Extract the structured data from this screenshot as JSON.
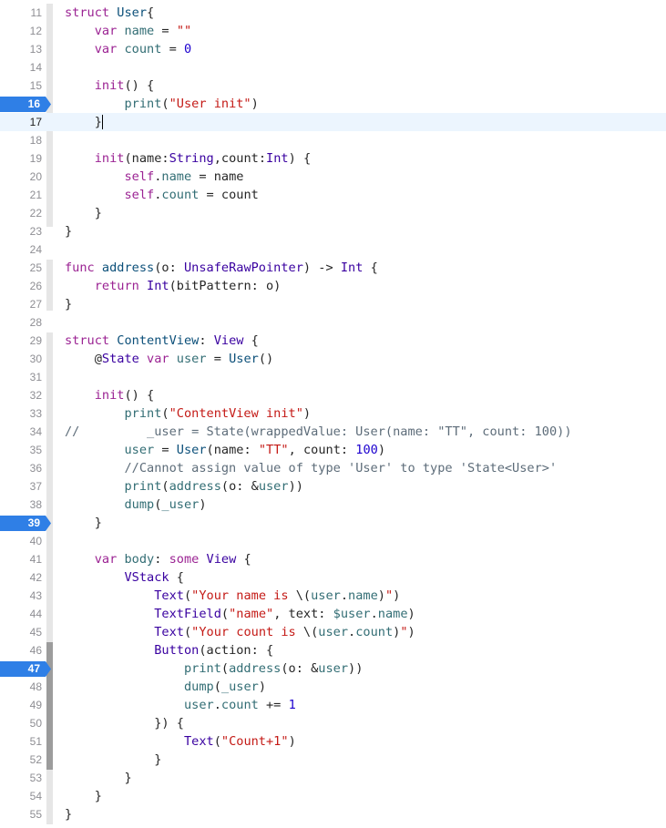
{
  "editor": {
    "colors": {
      "keyword": "#9b2393",
      "type": "#3900a0",
      "string": "#c41a16",
      "number": "#1c00cf",
      "function": "#326d74",
      "comment": "#5d6c79",
      "breakpoint": "#2f7fe6",
      "current_line": "#ecf5fe"
    },
    "current_line": 17,
    "breakpoints": [
      16,
      39,
      47
    ],
    "lines": [
      {
        "n": "11",
        "tokens": [
          [
            "kw",
            "struct "
          ],
          [
            "ty2",
            "User"
          ],
          [
            "",
            "{"
          ]
        ]
      },
      {
        "n": "12",
        "tokens": [
          [
            "",
            "    "
          ],
          [
            "kw",
            "var "
          ],
          [
            "fn",
            "name"
          ],
          [
            "",
            " = "
          ],
          [
            "str",
            "\"\""
          ]
        ]
      },
      {
        "n": "13",
        "tokens": [
          [
            "",
            "    "
          ],
          [
            "kw",
            "var "
          ],
          [
            "fn",
            "count"
          ],
          [
            "",
            " = "
          ],
          [
            "num",
            "0"
          ]
        ]
      },
      {
        "n": "14",
        "tokens": []
      },
      {
        "n": "15",
        "tokens": [
          [
            "",
            "    "
          ],
          [
            "kw",
            "init"
          ],
          [
            "",
            "() {"
          ]
        ]
      },
      {
        "n": "16",
        "tokens": [
          [
            "",
            "        "
          ],
          [
            "fn",
            "print"
          ],
          [
            "",
            "("
          ],
          [
            "str",
            "\"User init\""
          ],
          [
            "",
            ")"
          ]
        ]
      },
      {
        "n": "17",
        "tokens": [
          [
            "",
            "    }"
          ]
        ]
      },
      {
        "n": "18",
        "tokens": []
      },
      {
        "n": "19",
        "tokens": [
          [
            "",
            "    "
          ],
          [
            "kw",
            "init"
          ],
          [
            "",
            "(name:"
          ],
          [
            "ty",
            "String"
          ],
          [
            "",
            ",count:"
          ],
          [
            "ty",
            "Int"
          ],
          [
            "",
            ") {"
          ]
        ]
      },
      {
        "n": "20",
        "tokens": [
          [
            "",
            "        "
          ],
          [
            "kw",
            "self"
          ],
          [
            "",
            "."
          ],
          [
            "fn",
            "name"
          ],
          [
            "",
            " = name"
          ]
        ]
      },
      {
        "n": "21",
        "tokens": [
          [
            "",
            "        "
          ],
          [
            "kw",
            "self"
          ],
          [
            "",
            "."
          ],
          [
            "fn",
            "count"
          ],
          [
            "",
            " = count"
          ]
        ]
      },
      {
        "n": "22",
        "tokens": [
          [
            "",
            "    }"
          ]
        ]
      },
      {
        "n": "23",
        "tokens": [
          [
            "",
            "}"
          ]
        ]
      },
      {
        "n": "24",
        "tokens": []
      },
      {
        "n": "25",
        "tokens": [
          [
            "kw",
            "func "
          ],
          [
            "ty2",
            "address"
          ],
          [
            "",
            "(o: "
          ],
          [
            "ty",
            "UnsafeRawPointer"
          ],
          [
            "",
            ") -> "
          ],
          [
            "ty",
            "Int"
          ],
          [
            "",
            " {"
          ]
        ]
      },
      {
        "n": "26",
        "tokens": [
          [
            "",
            "    "
          ],
          [
            "kw",
            "return "
          ],
          [
            "ty",
            "Int"
          ],
          [
            "",
            "(bitPattern: o)"
          ]
        ]
      },
      {
        "n": "27",
        "tokens": [
          [
            "",
            "}"
          ]
        ]
      },
      {
        "n": "28",
        "tokens": []
      },
      {
        "n": "29",
        "tokens": [
          [
            "kw",
            "struct "
          ],
          [
            "ty2",
            "ContentView"
          ],
          [
            "",
            ": "
          ],
          [
            "ty",
            "View"
          ],
          [
            "",
            " {"
          ]
        ]
      },
      {
        "n": "30",
        "tokens": [
          [
            "",
            "    @"
          ],
          [
            "ty",
            "State"
          ],
          [
            "",
            " "
          ],
          [
            "kw",
            "var "
          ],
          [
            "fn",
            "user"
          ],
          [
            "",
            " = "
          ],
          [
            "ty2",
            "User"
          ],
          [
            "",
            "()"
          ]
        ]
      },
      {
        "n": "31",
        "tokens": []
      },
      {
        "n": "32",
        "tokens": [
          [
            "",
            "    "
          ],
          [
            "kw",
            "init"
          ],
          [
            "",
            "() {"
          ]
        ]
      },
      {
        "n": "33",
        "tokens": [
          [
            "",
            "        "
          ],
          [
            "fn",
            "print"
          ],
          [
            "",
            "("
          ],
          [
            "str",
            "\"ContentView init\""
          ],
          [
            "",
            ")"
          ]
        ]
      },
      {
        "n": "34",
        "tokens": [
          [
            "cm",
            "//         _user = State(wrappedValue: User(name: \"TT\", count: 100))"
          ]
        ]
      },
      {
        "n": "35",
        "tokens": [
          [
            "",
            "        "
          ],
          [
            "fn",
            "user"
          ],
          [
            "",
            " = "
          ],
          [
            "ty2",
            "User"
          ],
          [
            "",
            "(name: "
          ],
          [
            "str",
            "\"TT\""
          ],
          [
            "",
            ", count: "
          ],
          [
            "num",
            "100"
          ],
          [
            "",
            ")"
          ]
        ]
      },
      {
        "n": "36",
        "tokens": [
          [
            "",
            "        "
          ],
          [
            "cm",
            "//Cannot assign value of type 'User' to type 'State<User>'"
          ]
        ]
      },
      {
        "n": "37",
        "tokens": [
          [
            "",
            "        "
          ],
          [
            "fn",
            "print"
          ],
          [
            "",
            "("
          ],
          [
            "fn",
            "address"
          ],
          [
            "",
            "(o: &"
          ],
          [
            "fn",
            "user"
          ],
          [
            "",
            "))"
          ]
        ]
      },
      {
        "n": "38",
        "tokens": [
          [
            "",
            "        "
          ],
          [
            "fn",
            "dump"
          ],
          [
            "",
            "("
          ],
          [
            "fn",
            "_user"
          ],
          [
            "",
            ")"
          ]
        ]
      },
      {
        "n": "39",
        "tokens": [
          [
            "",
            "    }"
          ]
        ]
      },
      {
        "n": "40",
        "tokens": []
      },
      {
        "n": "41",
        "tokens": [
          [
            "",
            "    "
          ],
          [
            "kw",
            "var "
          ],
          [
            "fn",
            "body"
          ],
          [
            "",
            ": "
          ],
          [
            "kw",
            "some "
          ],
          [
            "ty",
            "View"
          ],
          [
            "",
            " {"
          ]
        ]
      },
      {
        "n": "42",
        "tokens": [
          [
            "",
            "        "
          ],
          [
            "ty",
            "VStack"
          ],
          [
            "",
            " {"
          ]
        ]
      },
      {
        "n": "43",
        "tokens": [
          [
            "",
            "            "
          ],
          [
            "ty",
            "Text"
          ],
          [
            "",
            "("
          ],
          [
            "str",
            "\"Your name is "
          ],
          [
            "",
            "\\("
          ],
          [
            "fn",
            "user"
          ],
          [
            "",
            "."
          ],
          [
            "fn",
            "name"
          ],
          [
            "",
            ")"
          ],
          [
            "str",
            "\""
          ],
          [
            "",
            ")"
          ]
        ]
      },
      {
        "n": "44",
        "tokens": [
          [
            "",
            "            "
          ],
          [
            "ty",
            "TextField"
          ],
          [
            "",
            "("
          ],
          [
            "str",
            "\"name\""
          ],
          [
            "",
            ", text: "
          ],
          [
            "fn",
            "$user"
          ],
          [
            "",
            "."
          ],
          [
            "fn",
            "name"
          ],
          [
            "",
            ")"
          ]
        ]
      },
      {
        "n": "45",
        "tokens": [
          [
            "",
            "            "
          ],
          [
            "ty",
            "Text"
          ],
          [
            "",
            "("
          ],
          [
            "str",
            "\"Your count is "
          ],
          [
            "",
            "\\("
          ],
          [
            "fn",
            "user"
          ],
          [
            "",
            "."
          ],
          [
            "fn",
            "count"
          ],
          [
            "",
            ")"
          ],
          [
            "str",
            "\""
          ],
          [
            "",
            ")"
          ]
        ]
      },
      {
        "n": "46",
        "tokens": [
          [
            "",
            "            "
          ],
          [
            "ty",
            "Button"
          ],
          [
            "",
            "(action: {"
          ]
        ]
      },
      {
        "n": "47",
        "tokens": [
          [
            "",
            "                "
          ],
          [
            "fn",
            "print"
          ],
          [
            "",
            "("
          ],
          [
            "fn",
            "address"
          ],
          [
            "",
            "(o: &"
          ],
          [
            "fn",
            "user"
          ],
          [
            "",
            "))"
          ]
        ]
      },
      {
        "n": "48",
        "tokens": [
          [
            "",
            "                "
          ],
          [
            "fn",
            "dump"
          ],
          [
            "",
            "("
          ],
          [
            "fn",
            "_user"
          ],
          [
            "",
            ")"
          ]
        ]
      },
      {
        "n": "49",
        "tokens": [
          [
            "",
            "                "
          ],
          [
            "fn",
            "user"
          ],
          [
            "",
            "."
          ],
          [
            "fn",
            "count"
          ],
          [
            "",
            " += "
          ],
          [
            "num",
            "1"
          ]
        ]
      },
      {
        "n": "50",
        "tokens": [
          [
            "",
            "            }) {"
          ]
        ]
      },
      {
        "n": "51",
        "tokens": [
          [
            "",
            "                "
          ],
          [
            "ty",
            "Text"
          ],
          [
            "",
            "("
          ],
          [
            "str",
            "\"Count+1\""
          ],
          [
            "",
            ")"
          ]
        ]
      },
      {
        "n": "52",
        "tokens": [
          [
            "",
            "            }"
          ]
        ]
      },
      {
        "n": "53",
        "tokens": [
          [
            "",
            "        }"
          ]
        ]
      },
      {
        "n": "54",
        "tokens": [
          [
            "",
            "    }"
          ]
        ]
      },
      {
        "n": "55",
        "tokens": [
          [
            "",
            "}"
          ]
        ]
      }
    ]
  }
}
